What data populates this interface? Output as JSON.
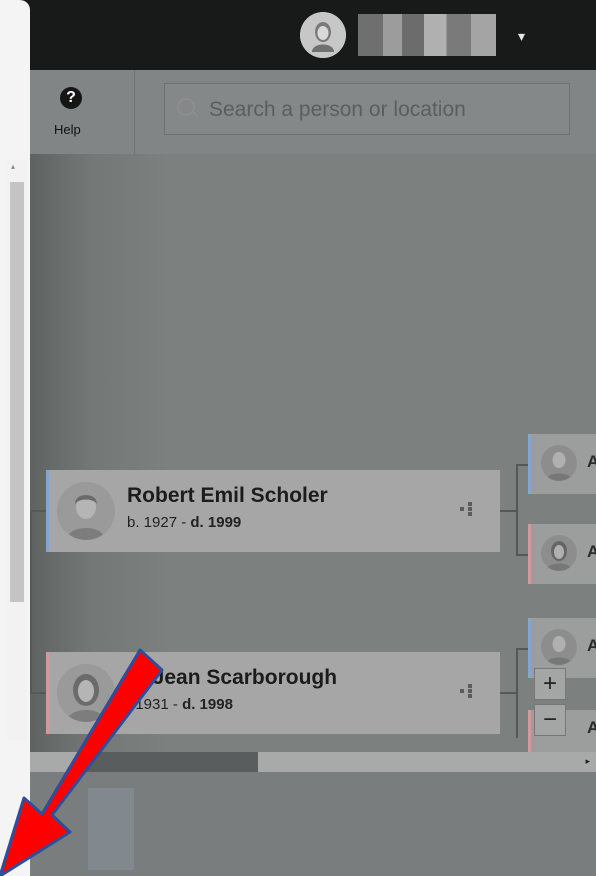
{
  "header": {
    "user_name": "",
    "dropdown_glyph": "▾"
  },
  "toolbar": {
    "help_icon_glyph": "?",
    "help_label": "Help",
    "search_placeholder": "Search a person or location",
    "search_value": ""
  },
  "tree": {
    "people": [
      {
        "name": "Robert Emil Scholer",
        "birth": "b. 1927",
        "separator": " - ",
        "death": "d. 1999",
        "gender": "male"
      },
      {
        "name": "ry Jean Scarborough",
        "birth": ". 1931",
        "separator": " - ",
        "death": "d. 1998",
        "gender": "female"
      }
    ],
    "parents": [
      {
        "gender": "male",
        "initial": "A"
      },
      {
        "gender": "female",
        "initial": "A"
      },
      {
        "gender": "male",
        "initial": "A"
      },
      {
        "gender": "female",
        "initial": "A"
      }
    ]
  },
  "zoom": {
    "in_label": "+",
    "out_label": "−"
  },
  "scrollbars": {
    "h_right_arrow": "▸",
    "v_up_arrow": "▴"
  },
  "colors": {
    "male_accent": "#7fa7d0",
    "female_accent": "#d29a9a",
    "annotation_red": "#ff0000",
    "annotation_outline": "#2e4e9a"
  }
}
